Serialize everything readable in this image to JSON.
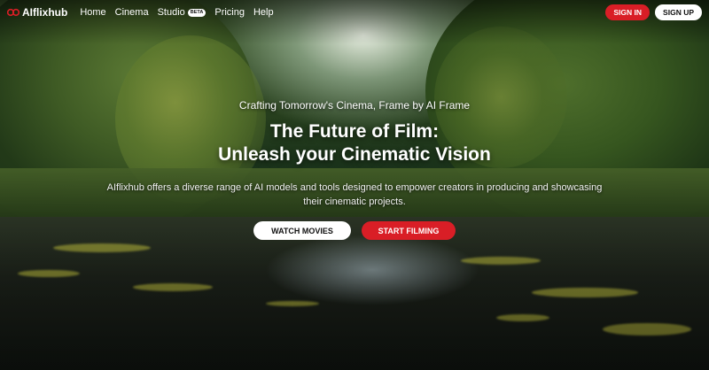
{
  "brand": {
    "name": "AIflixhub",
    "accent": "#d91e26"
  },
  "nav": {
    "links": [
      "Home",
      "Cinema",
      "Studio",
      "Pricing",
      "Help"
    ],
    "studio_badge": "BETA",
    "sign_in": "SIGN IN",
    "sign_up": "SIGN UP"
  },
  "hero": {
    "tagline": "Crafting Tomorrow's Cinema, Frame by AI Frame",
    "headline_line1": "The Future of Film:",
    "headline_line2": "Unleash your Cinematic Vision",
    "description": "AIflixhub offers a diverse range of AI models and tools designed to empower creators in producing and showcasing their cinematic projects.",
    "watch_button": "WATCH MOVIES",
    "start_button": "START FILMING",
    "background": "jungle river scene"
  }
}
